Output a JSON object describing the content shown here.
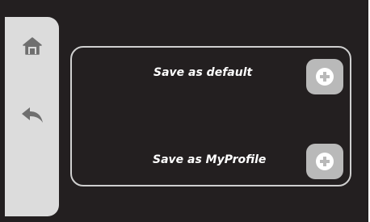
{
  "sidebar": {
    "items": [
      {
        "icon": "home-icon"
      },
      {
        "icon": "back-arrow-icon"
      }
    ]
  },
  "panel": {
    "rows": [
      {
        "label": "Save as default",
        "action_icon": "plus-circle-icon"
      },
      {
        "label": "Save as MyProfile",
        "action_icon": "plus-circle-icon"
      }
    ]
  },
  "colors": {
    "background": "#231f20",
    "sidebar": "#dcdcdc",
    "icon": "#6f6f6f",
    "panel_border": "#cfcfcf",
    "add_button": "#b9b9b9",
    "label_text": "#ffffff"
  }
}
